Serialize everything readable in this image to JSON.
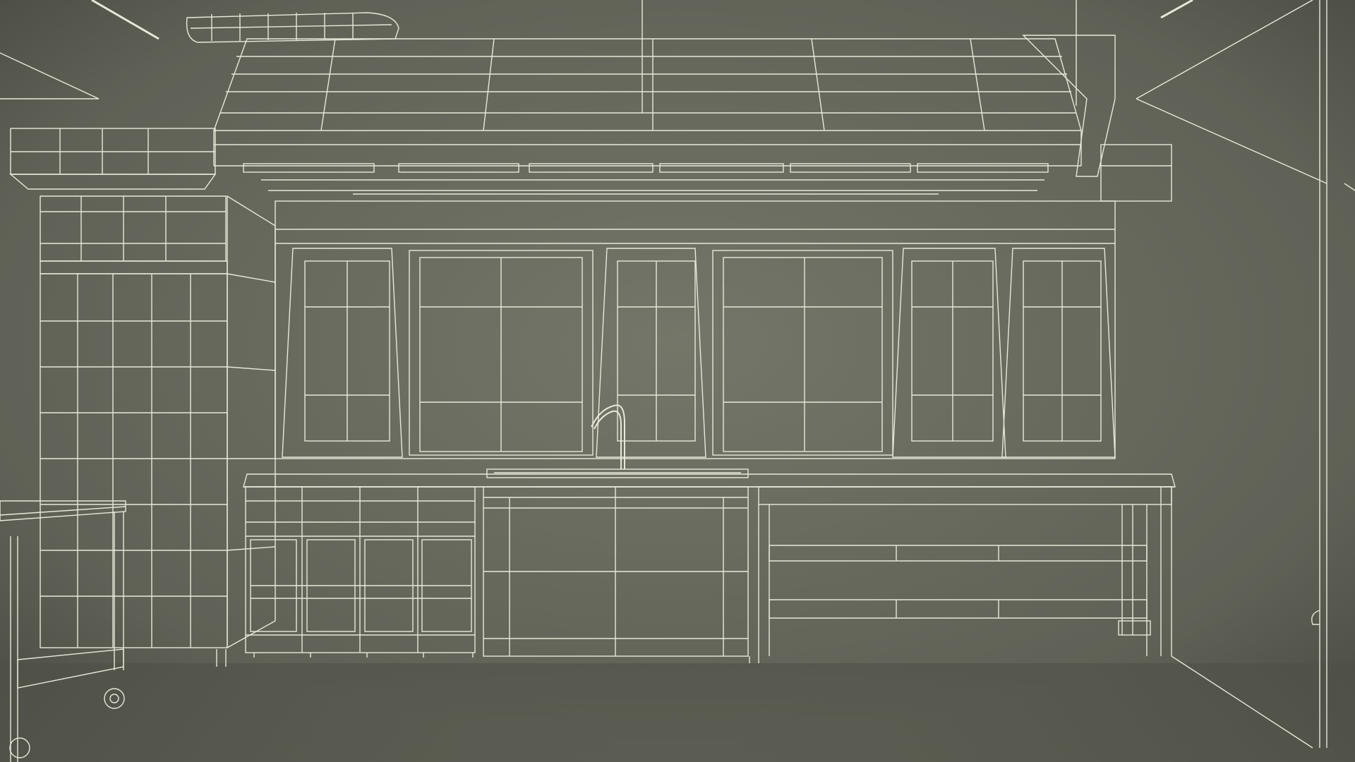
{
  "scene": {
    "subject": "commercial-kitchen-wireframe-render",
    "colors": {
      "background": "#5f6156",
      "wall": "#6b6d61",
      "floor": "#57594f",
      "wire": "#e8e8da",
      "wire_dim": "#c9cabb",
      "shadow": "#3f4139"
    }
  }
}
